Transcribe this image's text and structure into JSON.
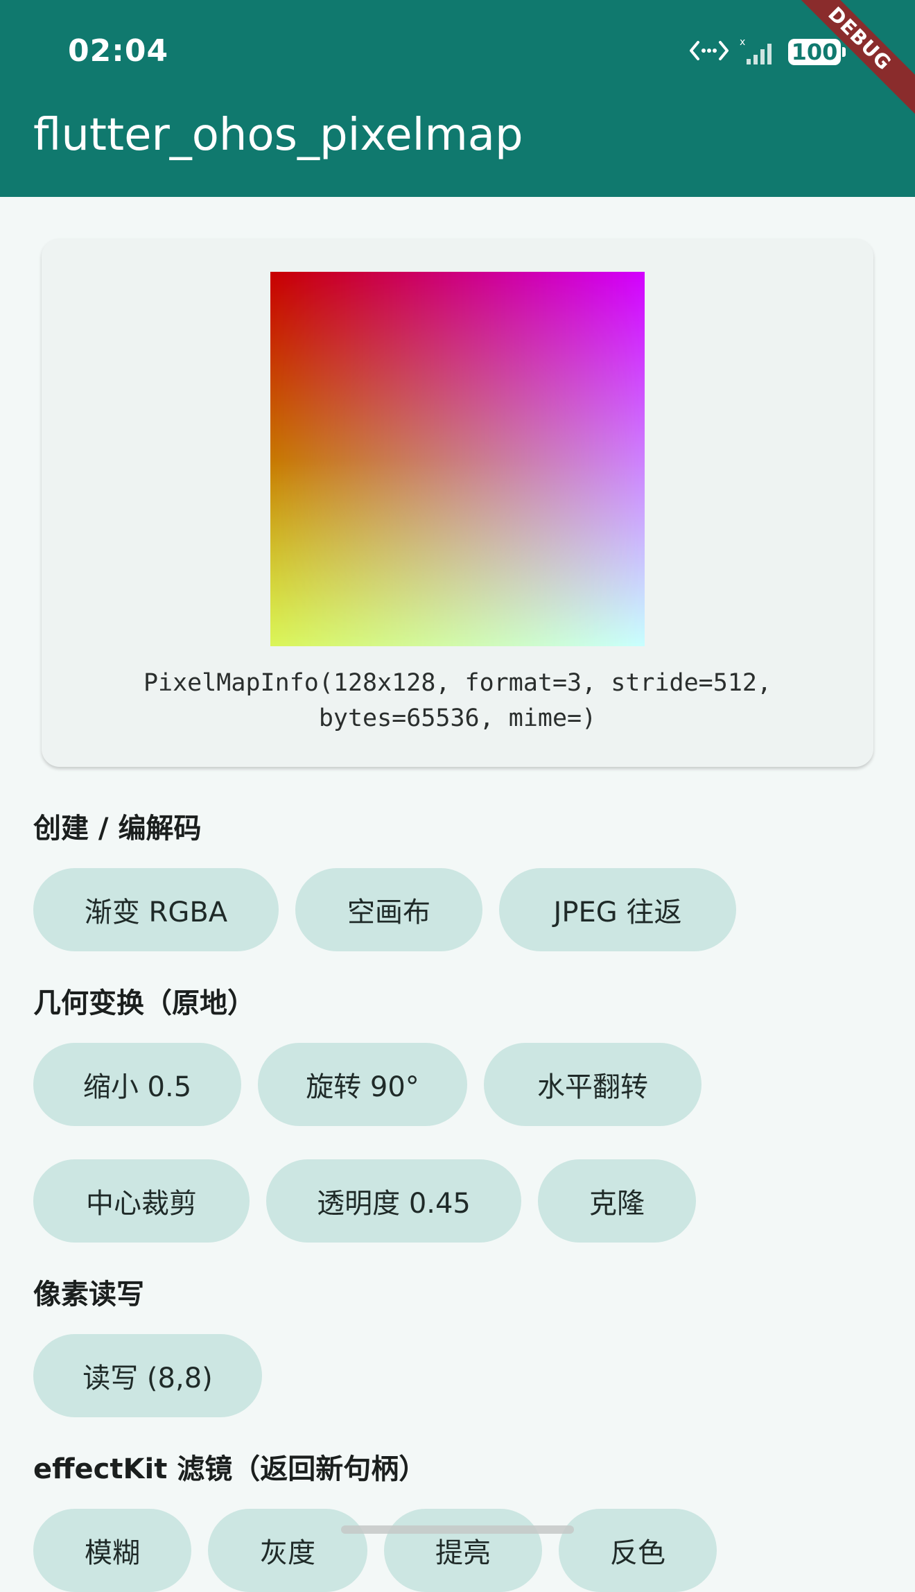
{
  "status_bar": {
    "time": "02:04",
    "battery": "100",
    "icons": [
      "data-transfer-icon",
      "no-signal-icon",
      "battery-icon"
    ]
  },
  "app_bar": {
    "title": "flutter_ohos_pixelmap",
    "debug_banner": "DEBUG"
  },
  "preview": {
    "info_line1": "PixelMapInfo(128x128, format=3, stride=512,",
    "info_line2": "bytes=65536, mime=)"
  },
  "sections": {
    "create": {
      "title": "创建 / 编解码",
      "buttons": [
        "渐变 RGBA",
        "空画布",
        "JPEG 往返"
      ]
    },
    "geometry": {
      "title": "几何变换（原地）",
      "buttons": [
        "缩小 0.5",
        "旋转 90°",
        "水平翻转",
        "中心裁剪",
        "透明度 0.45",
        "克隆"
      ]
    },
    "pixels": {
      "title": "像素读写",
      "buttons": [
        "读写 (8,8)"
      ]
    },
    "effect": {
      "title": "effectKit 滤镜（返回新句柄）",
      "buttons": [
        "模糊",
        "灰度",
        "提亮",
        "反色"
      ]
    }
  },
  "colors": {
    "app_bar": "#10796e",
    "background": "#f3f8f7",
    "button": "#cce6e2",
    "debug_banner": "#8a2c2c"
  }
}
